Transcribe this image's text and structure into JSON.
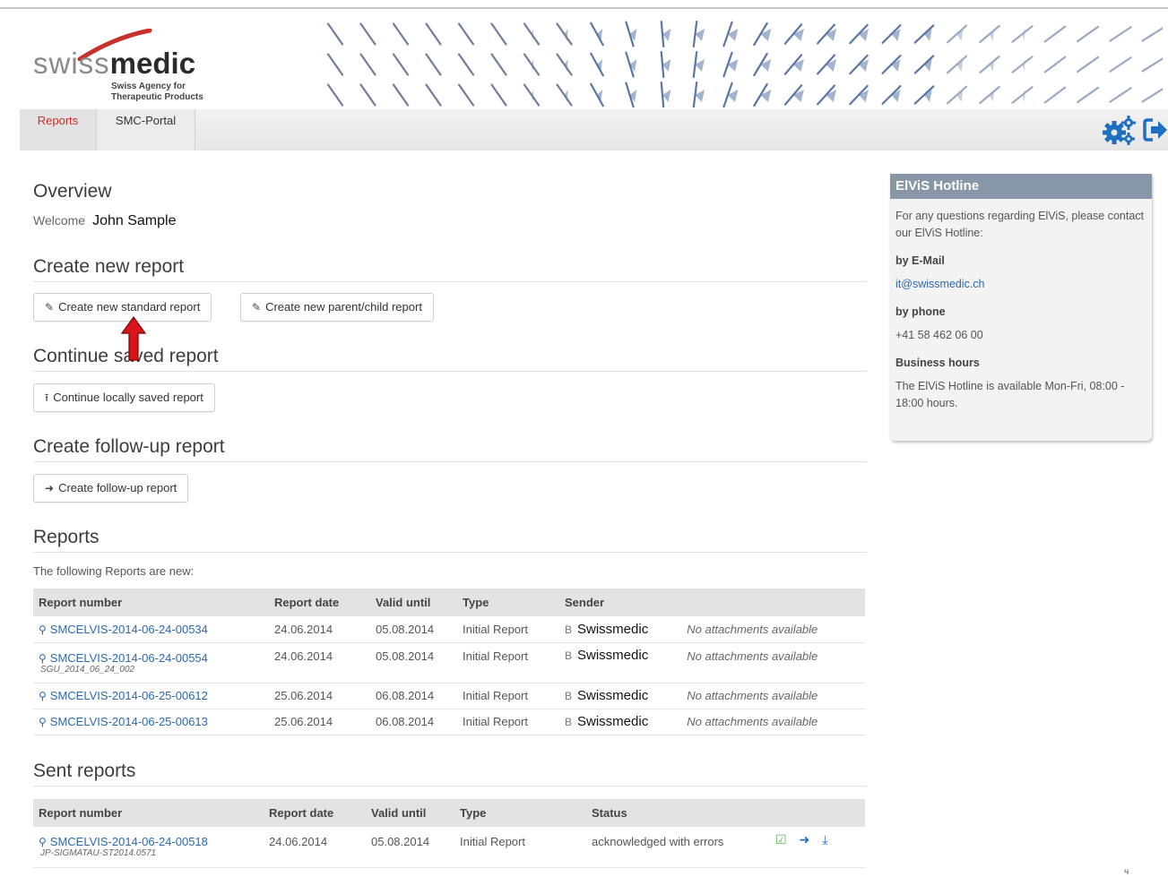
{
  "colors": {
    "accent_red": "#c9302c",
    "link_blue": "#2a6ab3",
    "hotline_header": "#8797a8",
    "icon_blue": "#1f6fc0",
    "ack_green": "#5cb85c"
  },
  "logo": {
    "word_part1": "swiss",
    "word_part2": "medic",
    "subtitle_line1": "Swiss Agency for",
    "subtitle_line2": "Therapeutic Products"
  },
  "nav": {
    "tabs": [
      {
        "label": "Reports",
        "active": true
      },
      {
        "label": "SMC-Portal",
        "active": false
      }
    ],
    "icons": [
      "gears-icon",
      "logout-icon"
    ]
  },
  "overview": {
    "title": "Overview",
    "welcome_label": "Welcome",
    "user_name": "John Sample"
  },
  "create_new": {
    "title": "Create new report",
    "standard_label": "Create new standard report",
    "parent_child_label": "Create new parent/child report"
  },
  "continue_saved": {
    "title": "Continue saved report",
    "button_label": "Continue locally saved report"
  },
  "follow_up": {
    "title": "Create follow-up report",
    "button_label": "Create follow-up report"
  },
  "reports": {
    "title": "Reports",
    "intro": "The following Reports are new:",
    "columns": [
      "Report number",
      "Report date",
      "Valid until",
      "Type",
      "Sender"
    ],
    "rows": [
      {
        "number": "SMCELVIS-2014-06-24-00534",
        "subref": "",
        "date": "24.06.2014",
        "valid": "05.08.2014",
        "type": "Initial Report",
        "sender_prefix": "B",
        "sender": "Swissmedic",
        "attachments": "No attachments available"
      },
      {
        "number": "SMCELVIS-2014-06-24-00554",
        "subref": "SGU_2014_06_24_002",
        "date": "24.06.2014",
        "valid": "05.08.2014",
        "type": "Initial Report",
        "sender_prefix": "B",
        "sender": "Swissmedic",
        "attachments": "No attachments available"
      },
      {
        "number": "SMCELVIS-2014-06-25-00612",
        "subref": "",
        "date": "25.06.2014",
        "valid": "06.08.2014",
        "type": "Initial Report",
        "sender_prefix": "B",
        "sender": "Swissmedic",
        "attachments": "No attachments available"
      },
      {
        "number": "SMCELVIS-2014-06-25-00613",
        "subref": "",
        "date": "25.06.2014",
        "valid": "06.08.2014",
        "type": "Initial Report",
        "sender_prefix": "B",
        "sender": "Swissmedic",
        "attachments": "No attachments available"
      }
    ]
  },
  "sent_reports": {
    "title": "Sent reports",
    "columns": [
      "Report number",
      "Report date",
      "Valid until",
      "Type",
      "Status"
    ],
    "rows": [
      {
        "number": "SMCELVIS-2014-06-24-00518",
        "subref": "JP-SIGMATAU-ST2014.0571",
        "date": "24.06.2014",
        "valid": "05.08.2014",
        "type": "Initial Report",
        "status": "acknowledged with errors",
        "action_icons": [
          "checkbox-icon",
          "forward-arrow-icon",
          "download-icon"
        ]
      }
    ]
  },
  "hotline": {
    "title": "ElViS Hotline",
    "intro": "For any questions regarding ElViS, please contact our ElViS Hotline:",
    "email_label": "by E-Mail",
    "email": "it@swissmedic.ch",
    "phone_label": "by phone",
    "phone": "+41 58 462 06 00",
    "hours_label": "Business hours",
    "hours": "The ElViS Hotline is available Mon-Fri, 08:00 - 18:00 hours."
  },
  "corner_mark": "ч"
}
